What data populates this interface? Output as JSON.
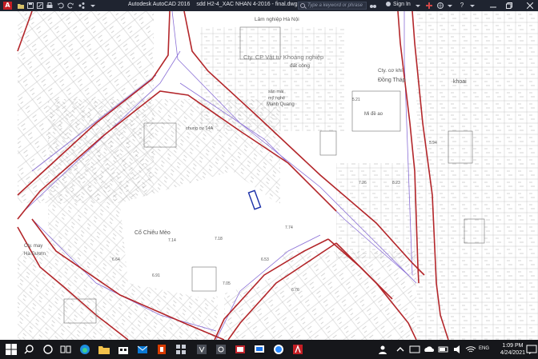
{
  "title_bar": {
    "app_name": "Autodesk AutoCAD 2016",
    "file_name": "sdd H2-4_XAC NHAN 4-2016 - final.dwg",
    "search_placeholder": "Type a keyword or phrase",
    "sign_in": "Sign In",
    "help_icon": "?"
  },
  "map": {
    "labels": {
      "lam_nghiep": "Lâm nghiệp Hà Nội",
      "cty_cp": "Cty. CP Vật tư Khoáng nghiệp",
      "dat_cong": "đất công",
      "cty_co_khi": "Cty. cơ khí",
      "dong_thap": "Đồng Tháp",
      "khoai": "khoai",
      "ban_mai": "sân mái",
      "mu_nghe": "mỹ nghệ",
      "manh_quang": "Mạnh Quang",
      "mi_de": "Mi đề ao",
      "chung_cu": "chung cư 14A",
      "co_chieu_meo": "Cổ Chiêu Mèo",
      "cty_may": "Cty. may",
      "ha_guom": "Hà Gươm",
      "num_714": "7.14",
      "num_718": "7.18",
      "num_705": "7.05",
      "num_691": "6.91",
      "num_664": "6.64",
      "num_774": "7.74",
      "num_676": "6.76",
      "num_653": "6.53",
      "num_521": "5.21",
      "num_594": "5.94",
      "num_726": "7.26",
      "num_823": "8.23"
    }
  },
  "taskbar": {
    "lang": "ENG",
    "time": "1:09 PM",
    "date": "4/24/2021"
  },
  "colors": {
    "road_edge": "#b3262a",
    "centerline": "#8a6fd6",
    "selection": "#1a2fa8",
    "linework": "#7d7d7d"
  }
}
